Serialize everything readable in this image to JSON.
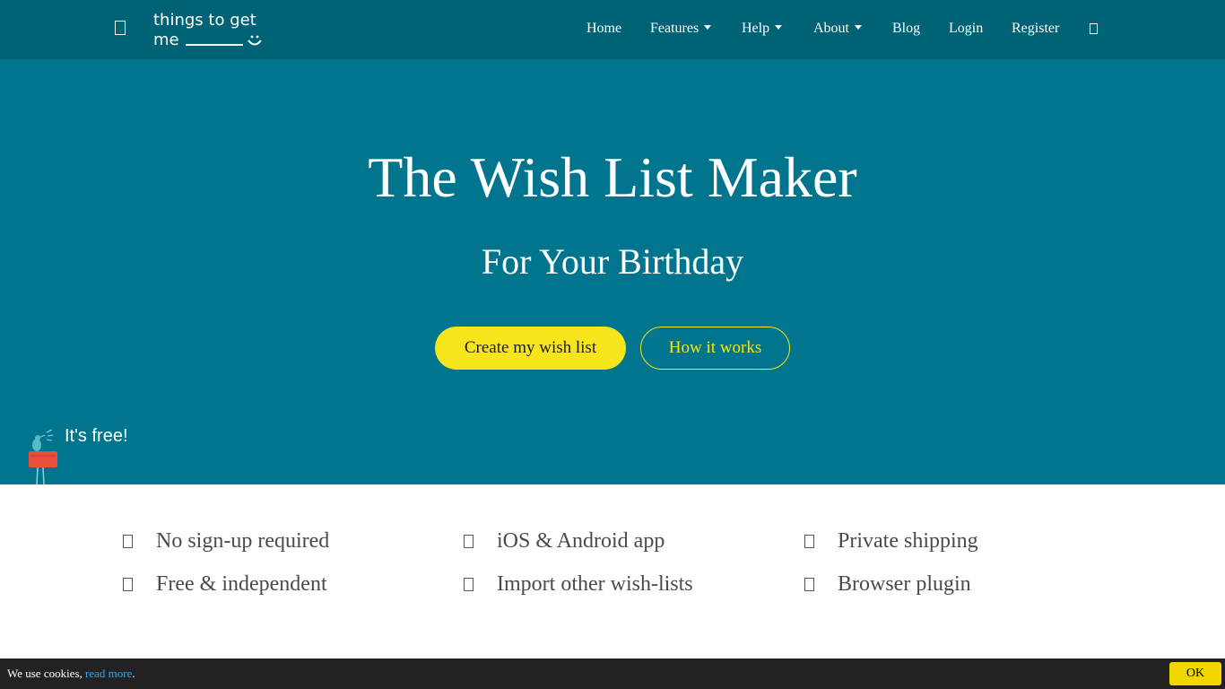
{
  "nav": {
    "logo_line1": "things to get",
    "logo_line2": "me",
    "items": [
      "Home",
      "Features",
      "Help",
      "About",
      "Blog",
      "Login",
      "Register"
    ]
  },
  "hero": {
    "title": "The Wish List Maker",
    "subtitle": "For Your Birthday",
    "primary_button": "Create my wish list",
    "secondary_button": "How it works",
    "free_label": "It's free!"
  },
  "features": [
    "No sign-up required",
    "iOS & Android app",
    "Private shipping",
    "Free & independent",
    "Import other wish-lists",
    "Browser plugin"
  ],
  "cookie": {
    "text": "We use cookies, ",
    "link": "read more",
    "suffix": ".",
    "ok": "OK"
  },
  "colors": {
    "nav_bg": "#006275",
    "hero_bg": "#00758d",
    "accent_yellow": "#f7e51c",
    "cookie_bg": "#222222"
  }
}
